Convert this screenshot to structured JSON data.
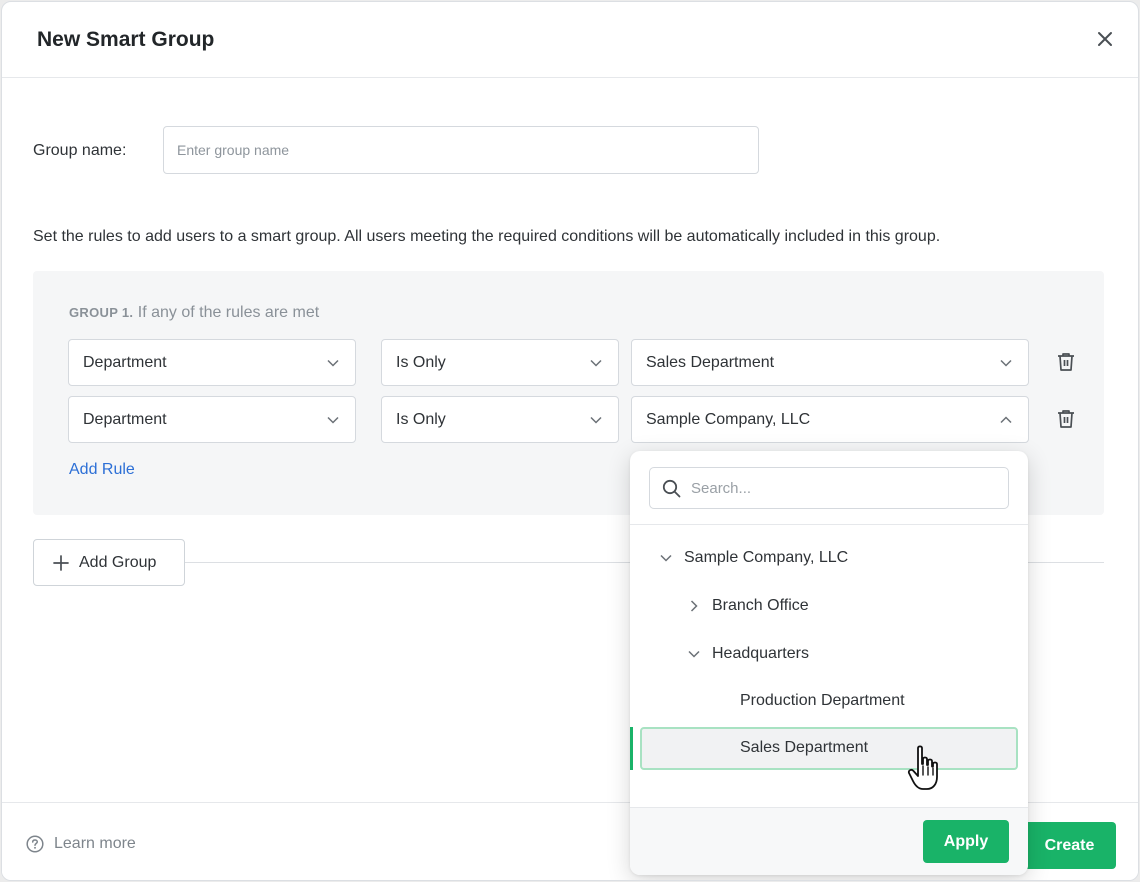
{
  "dialog": {
    "title": "New Smart Group",
    "close_label": "×"
  },
  "form": {
    "group_name_label": "Group name:",
    "group_name_placeholder": "Enter group name",
    "group_name_value": "",
    "description": "Set the rules to add users to a smart group. All users meeting the required conditions will be automatically included in this group."
  },
  "group": {
    "tag": "GROUP 1.",
    "condition": "If any of the rules are met",
    "rules": [
      {
        "field": "Department",
        "operator": "Is Only",
        "value": "Sales Department",
        "open": false
      },
      {
        "field": "Department",
        "operator": "Is Only",
        "value": "Sample Company, LLC",
        "open": true
      }
    ],
    "add_rule_label": "Add Rule"
  },
  "add_group_label": "Add Group",
  "dropdown": {
    "search_placeholder": "Search...",
    "tree": [
      {
        "label": "Sample Company, LLC",
        "expanded": true,
        "level": 0
      },
      {
        "label": "Branch Office",
        "expanded": false,
        "level": 1
      },
      {
        "label": "Headquarters",
        "expanded": true,
        "level": 1
      },
      {
        "label": "Production Department",
        "level": 2
      },
      {
        "label": "Sales Department",
        "level": 2,
        "selected": true
      }
    ],
    "apply_label": "Apply"
  },
  "footer": {
    "learn_more_label": "Learn more",
    "create_label": "Create"
  },
  "colors": {
    "accent_green": "#19b368",
    "link_blue": "#2c6fd6",
    "selection_border": "#a8e2c2"
  }
}
